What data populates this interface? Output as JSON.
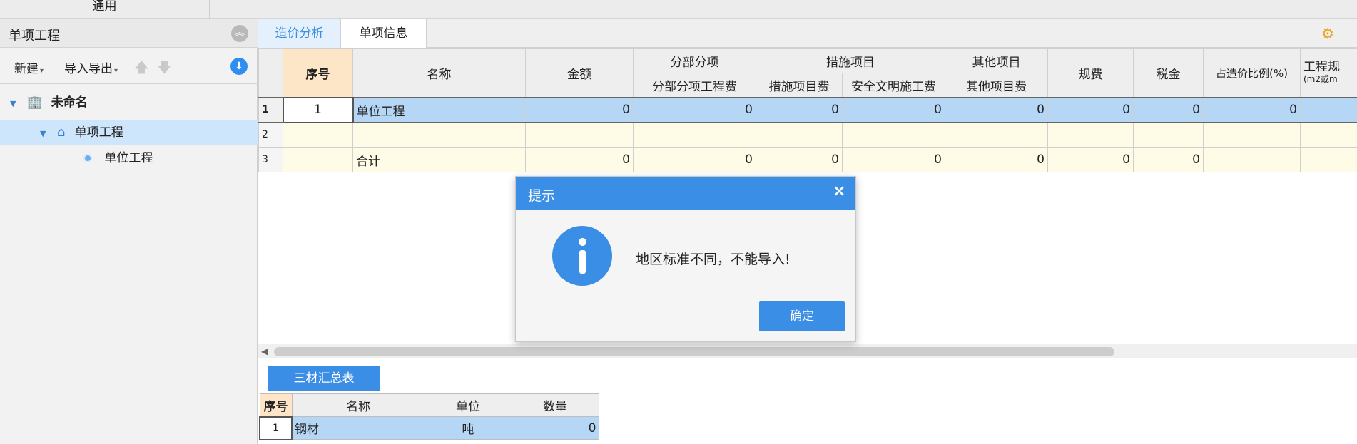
{
  "topbar": {
    "general_label": "通用"
  },
  "left_panel": {
    "title": "单项工程",
    "toolbar": {
      "new_label": "新建",
      "import_export_label": "导入导出"
    },
    "tree": [
      {
        "label": "未命名",
        "icon": "building-icon"
      },
      {
        "label": "单项工程",
        "icon": "home-icon"
      },
      {
        "label": "单位工程",
        "icon": "dot-icon"
      }
    ]
  },
  "tabs": [
    {
      "label": "造价分析",
      "active": true
    },
    {
      "label": "单项信息",
      "active": false
    }
  ],
  "grid": {
    "headers": {
      "seq": "序号",
      "name": "名称",
      "amount": "金额",
      "sub_group": "分部分项",
      "sub_fee": "分部分项工程费",
      "measure_group": "措施项目",
      "measure_fee": "措施项目费",
      "safety_fee": "安全文明施工费",
      "other_group": "其他项目",
      "other_fee": "其他项目费",
      "regulation_fee": "规费",
      "tax": "税金",
      "ratio": "占造价比例(%)",
      "scale": "工程规",
      "scale_unit": "(m2或m"
    },
    "rows": [
      {
        "rownum": "1",
        "seq": "1",
        "name": "单位工程",
        "amount": "0",
        "sub_fee": "0",
        "measure_fee": "0",
        "safety_fee": "0",
        "other_fee": "0",
        "regulation_fee": "0",
        "tax": "0",
        "ratio": "0",
        "scale": ""
      },
      {
        "rownum": "2",
        "seq": "",
        "name": "",
        "amount": "",
        "sub_fee": "",
        "measure_fee": "",
        "safety_fee": "",
        "other_fee": "",
        "regulation_fee": "",
        "tax": "",
        "ratio": "",
        "scale": ""
      },
      {
        "rownum": "3",
        "seq": "",
        "name": "合计",
        "amount": "0",
        "sub_fee": "0",
        "measure_fee": "0",
        "safety_fee": "0",
        "other_fee": "0",
        "regulation_fee": "0",
        "tax": "0",
        "ratio": "",
        "scale": ""
      }
    ]
  },
  "bottom": {
    "tab_label": "三材汇总表",
    "headers": {
      "seq": "序号",
      "name": "名称",
      "unit": "单位",
      "qty": "数量"
    },
    "rows": [
      {
        "seq": "1",
        "name": "钢材",
        "unit": "吨",
        "qty": "0"
      }
    ]
  },
  "dialog": {
    "title": "提示",
    "close": "×",
    "message": "地区标准不同，不能导入!",
    "ok_label": "确定"
  },
  "colors": {
    "accent": "#3a8ee6",
    "selection": "#b6d6f5",
    "row_bg": "#fefbe6",
    "seq_header": "#fde6c8"
  }
}
